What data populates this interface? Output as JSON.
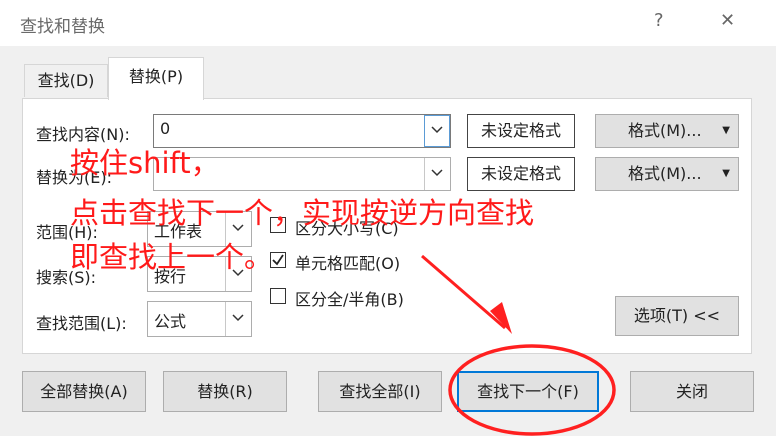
{
  "window": {
    "title": "查找和替换",
    "help_label": "?",
    "close_label": "✕"
  },
  "tabs": [
    {
      "label": "查找(D)"
    },
    {
      "label": "替换(P)"
    }
  ],
  "find": {
    "label": "查找内容(N):",
    "value": "0",
    "format_display": "未设定格式",
    "format_button": "格式(M)..."
  },
  "replace": {
    "label": "替换为(E):",
    "value": "",
    "format_display": "未设定格式",
    "format_button": "格式(M)..."
  },
  "options": {
    "scope": {
      "label": "范围(H):",
      "value": "工作表"
    },
    "search": {
      "label": "搜索(S):",
      "value": "按行"
    },
    "look_in": {
      "label": "查找范围(L):",
      "value": "公式"
    },
    "match_case": {
      "label": "区分大小写(C)",
      "checked": false
    },
    "match_cell": {
      "label": "单元格匹配(O)",
      "checked": true
    },
    "match_width": {
      "label": "区分全/半角(B)",
      "checked": false
    },
    "options_button": "选项(T) <<"
  },
  "buttons": {
    "replace_all": "全部替换(A)",
    "replace": "替换(R)",
    "find_all": "查找全部(I)",
    "find_next": "查找下一个(F)",
    "close": "关闭"
  },
  "annotation": {
    "lines": [
      "按住shift，",
      "点击查找下一个，实现按逆方向查找",
      "即查找上一个。"
    ],
    "color": "#ff1a1a"
  }
}
